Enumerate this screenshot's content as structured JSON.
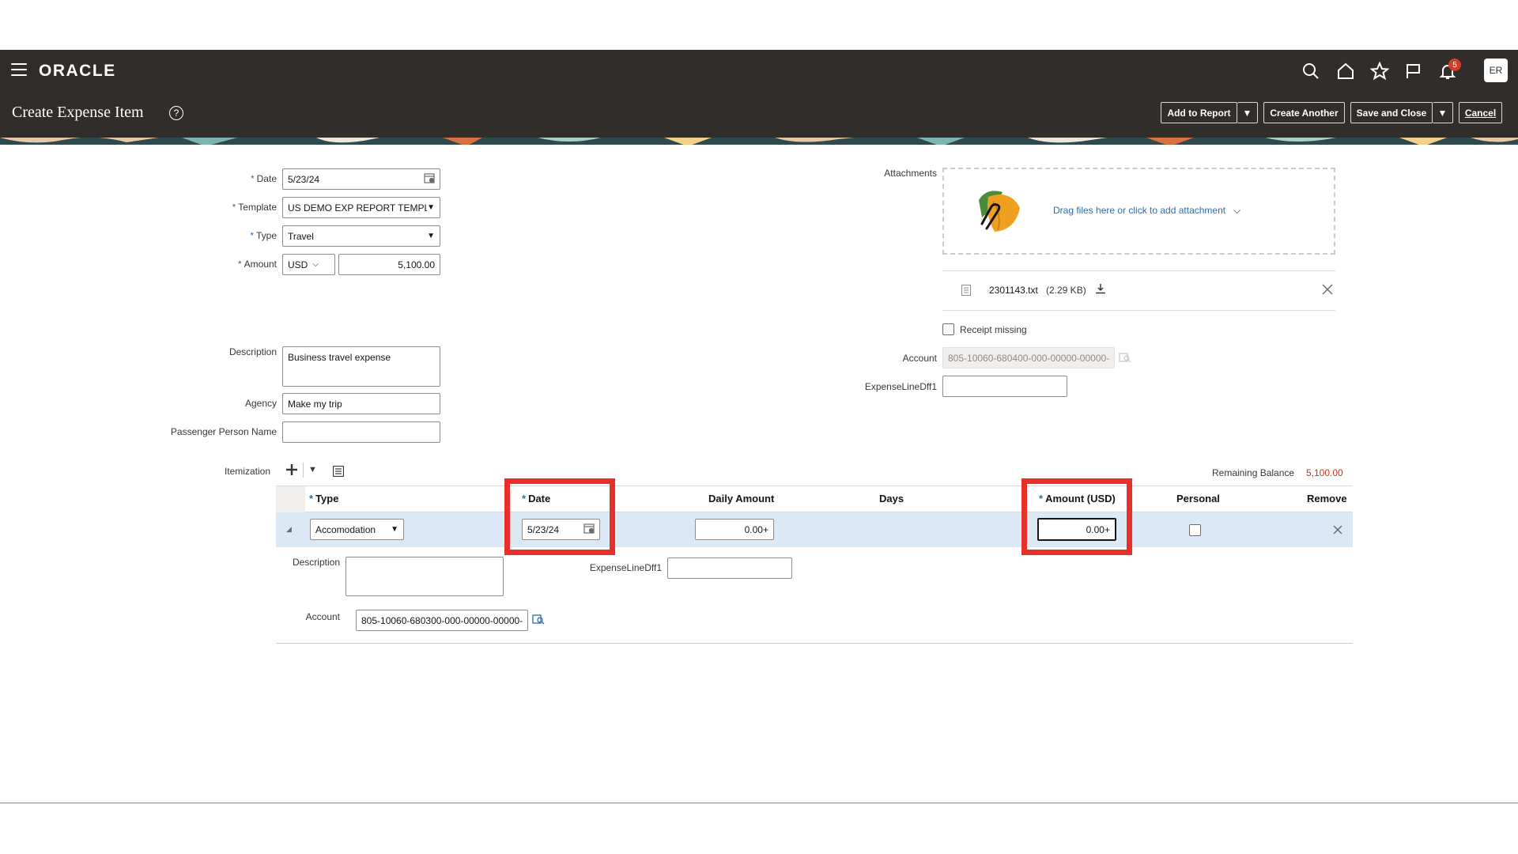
{
  "header": {
    "logo": "ORACLE",
    "notification_count": "5",
    "avatar_initials": "ER",
    "page_title": "Create Expense Item",
    "help_glyph": "?",
    "icons": [
      "menu-icon",
      "search-icon",
      "home-icon",
      "star-icon",
      "flag-icon",
      "bell-icon"
    ],
    "brand_color": "#312d2a"
  },
  "toolbar": {
    "add_to_report": "Add to Report",
    "create_another": "Create Another",
    "save_and_close": "Save and Close",
    "cancel": "Cancel"
  },
  "form": {
    "required_mark": "*",
    "date_label": "Date",
    "date_value": "5/23/24",
    "template_label": "Template",
    "template_value": "US DEMO EXP REPORT TEMPL",
    "type_label": "Type",
    "type_value": "Travel",
    "amount_label": "Amount",
    "currency_value": "USD",
    "amount_value": "5,100.00",
    "description_label": "Description",
    "description_value": "Business travel expense",
    "agency_label": "Agency",
    "agency_value": "Make my trip",
    "passenger_label": "Passenger Person Name",
    "passenger_value": ""
  },
  "attachments": {
    "label": "Attachments",
    "drop_text": "Drag files here or click to add attachment",
    "file_name": "2301143.txt",
    "file_size": "(2.29 KB)",
    "receipt_missing_label": "Receipt missing",
    "account_label": "Account",
    "account_value": "805-10060-680400-000-00000-00000-(",
    "dff_label": "ExpenseLineDff1",
    "dff_value": ""
  },
  "itemization": {
    "label": "Itemization",
    "remaining_label": "Remaining Balance",
    "remaining_value": "5,100.00",
    "columns": {
      "type": "Type",
      "date": "Date",
      "daily_amount": "Daily Amount",
      "days": "Days",
      "amount_usd": "Amount (USD)",
      "personal": "Personal",
      "remove": "Remove"
    },
    "row": {
      "type_value": "Accomodation",
      "date_value": "5/23/24",
      "daily_amount_value": "0.00+",
      "amount_value": "0.00+",
      "description_label": "Description",
      "description_value": "",
      "dff_label": "ExpenseLineDff1",
      "dff_value": "",
      "account_label": "Account",
      "account_value": "805-10060-680300-000-00000-00000-("
    },
    "highlight_color": "#e8302b"
  }
}
